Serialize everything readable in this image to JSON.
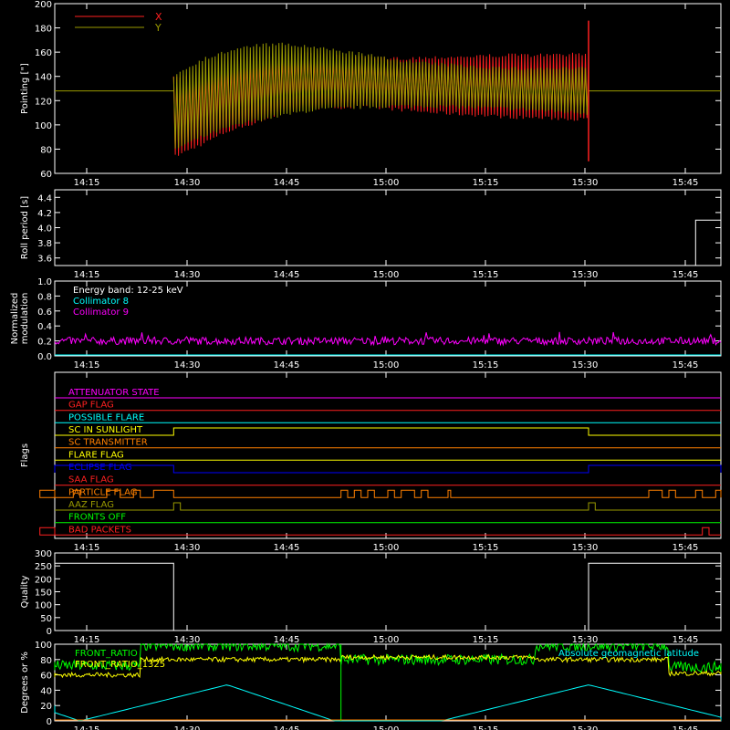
{
  "time_ticks": [
    "14:15",
    "14:30",
    "14:45",
    "15:00",
    "15:15",
    "15:30",
    "15:45"
  ],
  "colors": {
    "background": "#000000",
    "axis": "#ffffff",
    "x_series": "#ff0000",
    "y_series": "#808000",
    "white": "#ffffff",
    "cyan": "#00ffff",
    "magenta": "#ff00ff",
    "green": "#00ff00",
    "yellow": "#ffff00",
    "orange": "#ff8000",
    "red": "#ff2020",
    "blue": "#0000ff",
    "olive": "#9a9a00"
  },
  "chart_data": [
    {
      "panel": "pointing",
      "type": "line",
      "ylabel": "Pointing [\"]",
      "ylim": [
        60,
        200
      ],
      "yticks": [
        "60",
        "80",
        "100",
        "120",
        "140",
        "160",
        "180",
        "200"
      ],
      "xrange": [
        "14:07",
        "15:52"
      ],
      "active_interval": [
        "14:28",
        "15:30"
      ],
      "baseline": 128,
      "series": [
        {
          "name": "X",
          "color": "red",
          "envelope_x": [
            "14:28",
            "14:32",
            "14:36",
            "14:40",
            "14:44",
            "14:48",
            "14:52",
            "14:56",
            "15:00",
            "15:06",
            "15:12",
            "15:18",
            "15:24",
            "15:30"
          ],
          "upper": [
            140,
            145,
            152,
            157,
            160,
            160,
            158,
            157,
            156,
            157,
            158,
            159,
            159,
            160
          ],
          "lower": [
            72,
            82,
            93,
            100,
            108,
            112,
            113,
            113,
            112,
            109,
            107,
            105,
            104,
            103
          ]
        },
        {
          "name": "Y",
          "color": "olive",
          "envelope_x": [
            "14:28",
            "14:32",
            "14:36",
            "14:40",
            "14:44",
            "14:48",
            "14:52",
            "14:56",
            "15:00",
            "15:06",
            "15:12",
            "15:18",
            "15:24",
            "15:30"
          ],
          "upper": [
            142,
            155,
            162,
            167,
            168,
            166,
            163,
            160,
            156,
            152,
            150,
            148,
            148,
            148
          ],
          "lower": [
            78,
            88,
            96,
            102,
            106,
            110,
            112,
            113,
            114,
            114,
            113,
            112,
            110,
            108
          ]
        }
      ],
      "spike_at": "15:30",
      "spike_range": [
        70,
        186
      ]
    },
    {
      "panel": "roll_period",
      "type": "line",
      "ylabel": "Roll period [s]",
      "ylim": [
        3.5,
        4.5
      ],
      "yticks": [
        "3.6",
        "3.8",
        "4.0",
        "4.2",
        "4.4"
      ],
      "series": [
        {
          "name": "",
          "color": "white",
          "x": [
            "15:46",
            "15:52"
          ],
          "y": [
            4.1,
            4.1
          ]
        }
      ]
    },
    {
      "panel": "modulation",
      "type": "line",
      "ylabel": "Normalized modulation",
      "ylim": [
        0,
        1.0
      ],
      "yticks": [
        "0.0",
        "0.2",
        "0.4",
        "0.6",
        "0.8",
        "1.0"
      ],
      "annotation": "Energy band: 12-25 keV",
      "series": [
        {
          "name": "Collimator 8",
          "color": "cyan",
          "mean": 0.0
        },
        {
          "name": "Collimator 9",
          "color": "magenta",
          "mean": 0.2,
          "noise": 0.05
        }
      ]
    },
    {
      "panel": "flags",
      "type": "line",
      "ylabel": "Flags",
      "flags": [
        {
          "name": "ATTENUATOR STATE",
          "color": "magenta",
          "segments": []
        },
        {
          "name": "GAP FLAG",
          "color": "red",
          "segments": []
        },
        {
          "name": "POSSIBLE FLARE",
          "color": "cyan",
          "segments": []
        },
        {
          "name": "SC IN SUNLIGHT",
          "color": "yellow",
          "segments": [
            [
              "14:28",
              "15:30"
            ]
          ]
        },
        {
          "name": "SC TRANSMITTER",
          "color": "orange",
          "segments": []
        },
        {
          "name": "FLARE FLAG",
          "color": "yellow",
          "segments": []
        },
        {
          "name": "ECLIPSE FLAG",
          "color": "blue",
          "segments": [
            [
              "14:07",
              "14:28"
            ],
            [
              "15:30",
              "15:52"
            ]
          ]
        },
        {
          "name": "SAA FLAG",
          "color": "red",
          "segments": []
        },
        {
          "name": "PARTICLE FLAG",
          "color": "orange",
          "segments": [
            [
              "14:07",
              "14:08"
            ],
            [
              "14:13",
              "14:14"
            ],
            [
              "14:18",
              "14:20"
            ],
            [
              "14:22",
              "14:23"
            ],
            [
              "14:25",
              "14:28"
            ],
            [
              "14:53",
              "14:54"
            ],
            [
              "14:55",
              "14:56"
            ],
            [
              "14:57",
              "14:58"
            ],
            [
              "15:00",
              "15:01"
            ],
            [
              "15:02",
              "15:04"
            ],
            [
              "15:05",
              "15:06"
            ],
            [
              "15:09",
              "15:09.4"
            ],
            [
              "15:39",
              "15:41"
            ],
            [
              "15:42",
              "15:43"
            ],
            [
              "15:46",
              "15:47"
            ],
            [
              "15:49",
              "15:50"
            ]
          ]
        },
        {
          "name": "AAZ FLAG",
          "color": "olive",
          "segments": [
            [
              "14:28",
              "14:29"
            ],
            [
              "15:30",
              "15:31"
            ]
          ]
        },
        {
          "name": "FRONTS OFF",
          "color": "green",
          "segments": []
        },
        {
          "name": "BAD PACKETS",
          "color": "red",
          "segments": [
            [
              "14:07",
              "14:08"
            ],
            [
              "15:47",
              "15:48"
            ]
          ]
        }
      ]
    },
    {
      "panel": "quality",
      "type": "line",
      "ylabel": "Quality",
      "ylim": [
        0,
        300
      ],
      "yticks": [
        "0",
        "50",
        "100",
        "150",
        "200",
        "250",
        "300"
      ],
      "series": [
        {
          "name": "",
          "color": "white",
          "x": [
            "14:07",
            "14:28",
            "14:28",
            "15:30",
            "15:30",
            "15:52"
          ],
          "y": [
            260,
            260,
            0,
            0,
            260,
            260
          ]
        }
      ]
    },
    {
      "panel": "geo",
      "type": "line",
      "ylabel": "Degrees or %",
      "ylim": [
        0,
        100
      ],
      "yticks": [
        "0",
        "20",
        "40",
        "60",
        "80",
        "100"
      ],
      "series": [
        {
          "name": "FRONT_RATIO",
          "color": "green",
          "x": [
            "14:07",
            "14:23",
            "14:23",
            "14:53",
            "14:53",
            "15:22",
            "15:22",
            "15:42",
            "15:42",
            "15:52"
          ],
          "y": [
            72,
            72,
            98,
            98,
            80,
            80,
            98,
            98,
            70,
            70
          ]
        },
        {
          "name": "FRONT_RATIO_1325",
          "color": "yellow",
          "x": [
            "14:07",
            "14:23",
            "14:23",
            "14:53",
            "14:53",
            "15:22",
            "15:22",
            "15:42",
            "15:42",
            "15:52"
          ],
          "y": [
            60,
            60,
            80,
            80,
            83,
            83,
            80,
            80,
            62,
            62
          ]
        },
        {
          "name": "Absolute geomagnetic latitude",
          "color": "cyan",
          "x": [
            "14:07",
            "14:14",
            "14:36",
            "14:52",
            "15:08",
            "15:30",
            "15:52"
          ],
          "y": [
            20,
            0,
            47,
            0,
            0,
            47,
            0
          ]
        }
      ],
      "vline_at": "14:53"
    }
  ]
}
